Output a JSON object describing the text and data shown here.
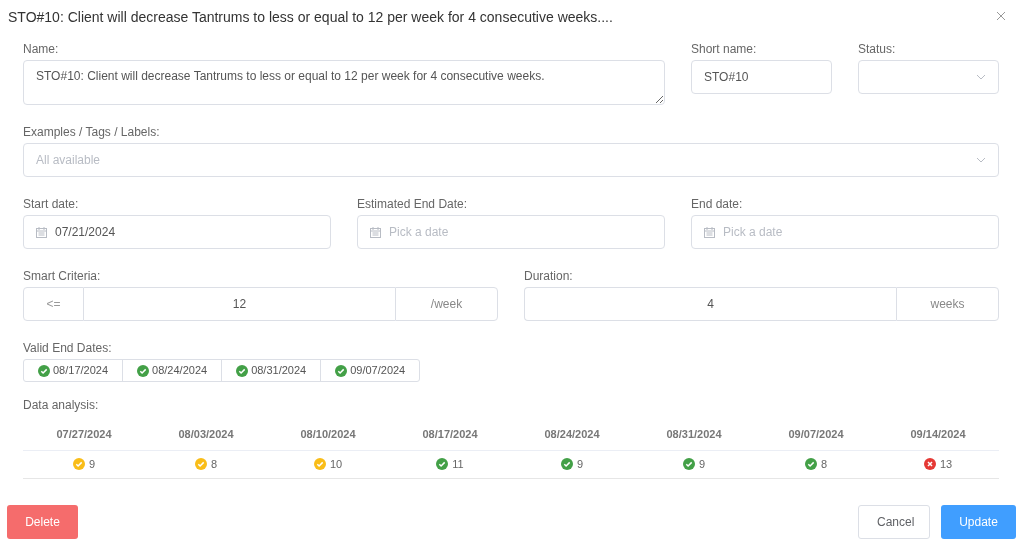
{
  "title": "STO#10: Client will decrease Tantrums to less or equal to 12 per week for 4 consecutive weeks....",
  "name": {
    "label": "Name:",
    "value": "STO#10: Client will decrease Tantrums to less or equal to 12 per week for 4 consecutive weeks."
  },
  "short_name": {
    "label": "Short name:",
    "value": "STO#10"
  },
  "status": {
    "label": "Status:"
  },
  "tags": {
    "label": "Examples / Tags / Labels:",
    "placeholder": "All available"
  },
  "dates": [
    {
      "label": "Start date:",
      "value": "07/21/2024"
    },
    {
      "label": "Estimated End Date:",
      "placeholder": "Pick a date"
    },
    {
      "label": "End date:",
      "placeholder": "Pick a date"
    }
  ],
  "smart_criteria": {
    "label": "Smart Criteria:",
    "operator": "<=",
    "value": "12",
    "unit": "/week"
  },
  "duration": {
    "label": "Duration:",
    "value": "4",
    "unit": "weeks"
  },
  "valid_end_dates": {
    "label": "Valid End Dates:",
    "items": [
      {
        "date": "08/17/2024",
        "color": "#43a047"
      },
      {
        "date": "08/24/2024",
        "color": "#43a047"
      },
      {
        "date": "08/31/2024",
        "color": "#43a047"
      },
      {
        "date": "09/07/2024",
        "color": "#43a047"
      }
    ]
  },
  "data_analysis": {
    "label": "Data analysis:",
    "columns": [
      {
        "date": "07/27/2024",
        "value": "9",
        "kind": "check",
        "color": "#f9bd18"
      },
      {
        "date": "08/03/2024",
        "value": "8",
        "kind": "check",
        "color": "#f9bd18"
      },
      {
        "date": "08/10/2024",
        "value": "10",
        "kind": "check",
        "color": "#f9bd18"
      },
      {
        "date": "08/17/2024",
        "value": "11",
        "kind": "check",
        "color": "#43a047"
      },
      {
        "date": "08/24/2024",
        "value": "9",
        "kind": "check",
        "color": "#43a047"
      },
      {
        "date": "08/31/2024",
        "value": "9",
        "kind": "check",
        "color": "#43a047"
      },
      {
        "date": "09/07/2024",
        "value": "8",
        "kind": "check",
        "color": "#43a047"
      },
      {
        "date": "09/14/2024",
        "value": "13",
        "kind": "cross",
        "color": "#e53935"
      }
    ]
  },
  "buttons": {
    "delete": "Delete",
    "cancel": "Cancel",
    "update": "Update"
  }
}
